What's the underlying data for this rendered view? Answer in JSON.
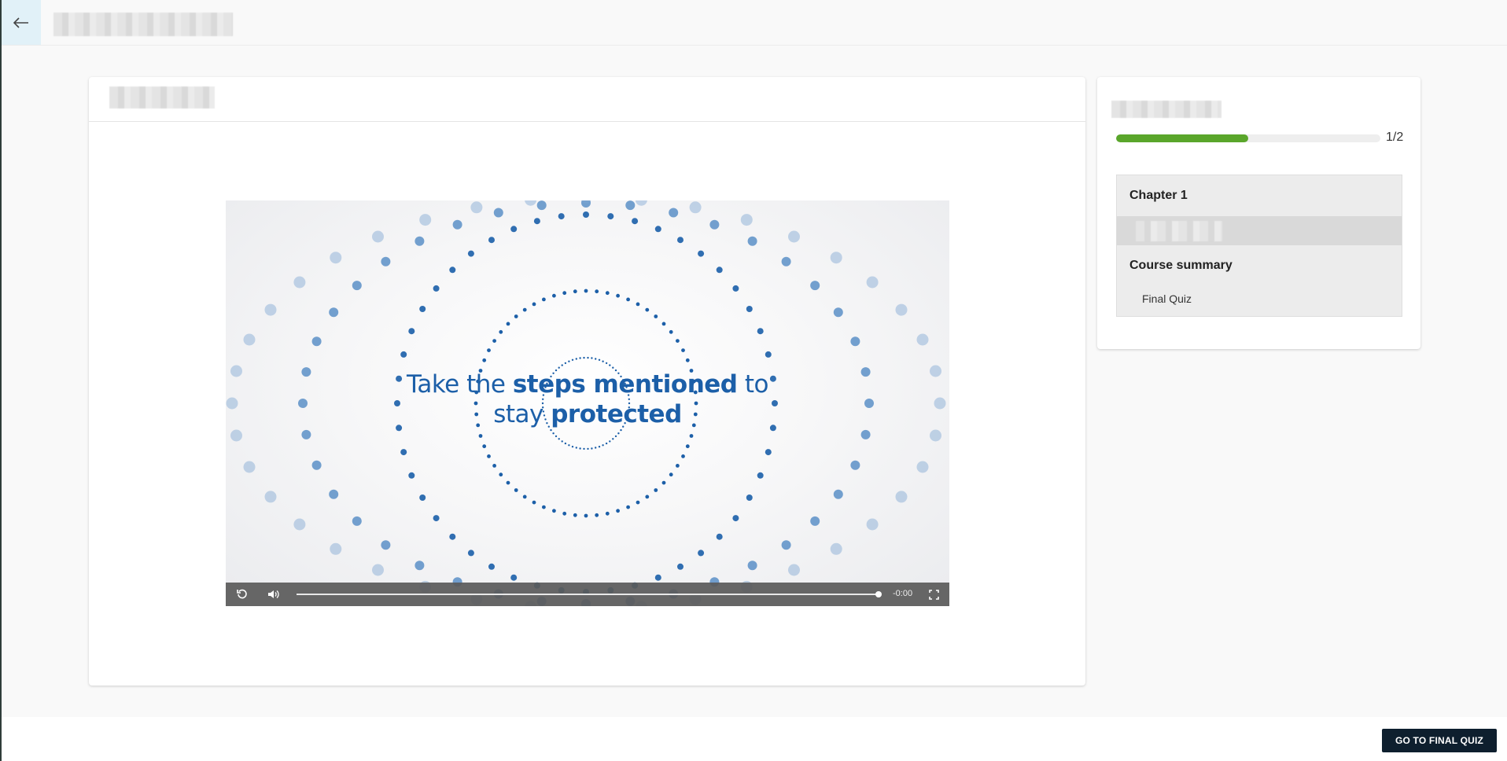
{
  "video": {
    "text_pre": "Take the ",
    "text_bold1": "steps mentioned",
    "text_mid": " to",
    "text_line2_pre": "stay ",
    "text_bold2": "protected",
    "time": "-0:00",
    "played_fraction": 1.0
  },
  "sidebar": {
    "progress": {
      "label": "1/2",
      "fraction": 0.5
    },
    "outline": {
      "chapter": "Chapter 1",
      "summary": "Course summary",
      "quiz": "Final Quiz"
    }
  },
  "footer": {
    "quiz_button": "GO TO FINAL QUIZ"
  },
  "colors": {
    "accent": "#1c5fa8",
    "progress": "#5aa62b",
    "button": "#0e1f2e"
  },
  "icons": [
    "back-arrow-icon",
    "replay-icon",
    "volume-icon",
    "fullscreen-icon"
  ]
}
